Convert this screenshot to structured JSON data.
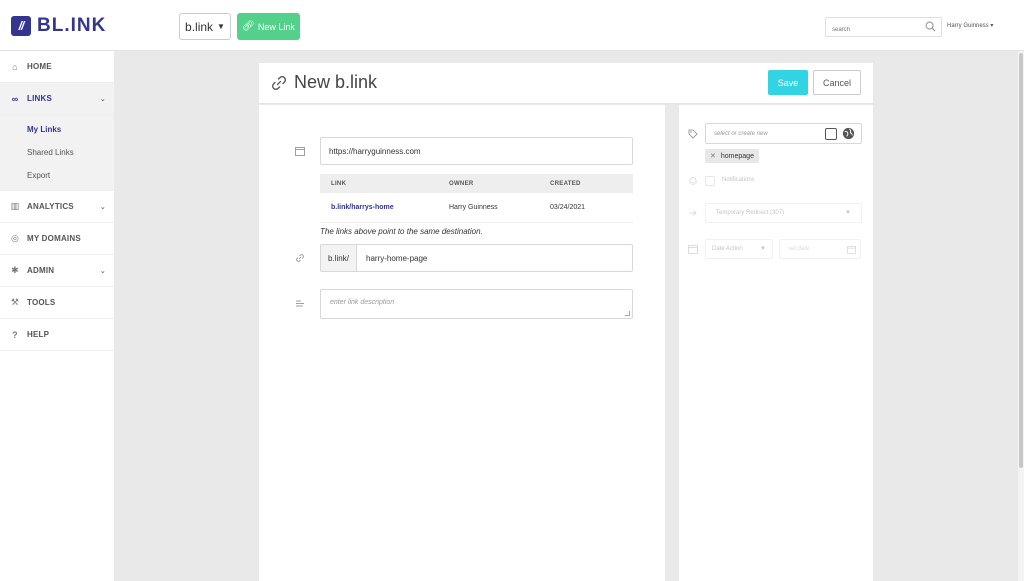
{
  "app": {
    "logo_text": "BL.INK",
    "logo_mark": "//"
  },
  "topbar": {
    "brand_select": "b.link",
    "new_link_label": "New Link",
    "search_placeholder": "search",
    "user_name": "Harry Guinness"
  },
  "sidebar": {
    "items": [
      {
        "label": "HOME",
        "icon": "home-icon"
      },
      {
        "label": "LINKS",
        "icon": "link-icon"
      },
      {
        "label": "ANALYTICS",
        "icon": "chart-icon"
      },
      {
        "label": "MY DOMAINS",
        "icon": "pin-icon"
      },
      {
        "label": "ADMIN",
        "icon": "gear-icon"
      },
      {
        "label": "TOOLS",
        "icon": "wrench-icon"
      },
      {
        "label": "HELP",
        "icon": "help-icon"
      }
    ],
    "links_sub": [
      "My Links",
      "Shared Links",
      "Export"
    ]
  },
  "panel": {
    "title": "New b.link",
    "save_label": "Save",
    "cancel_label": "Cancel"
  },
  "form": {
    "destination_url": "https://harryguinness.com",
    "match_table": {
      "headers": [
        "LINK",
        "OWNER",
        "CREATED"
      ],
      "rows": [
        [
          "b.link/harrys-home",
          "Harry Guinness",
          "03/24/2021"
        ]
      ]
    },
    "match_note": "The links above point to the same destination.",
    "slug_prefix": "b.link/",
    "slug_value": "harry-home-page",
    "description_placeholder": "enter link description"
  },
  "options": {
    "tag_placeholder": "select or create new",
    "tags": [
      "homepage"
    ],
    "notifications_label": "Notifications",
    "redirect_type": "Temporary Redirect (307)",
    "date_action": "Date Action",
    "date_placeholder": "set date"
  },
  "colors": {
    "brand": "#33358e",
    "new_link_button": "#53d08a",
    "save_button": "#32d3e3"
  }
}
